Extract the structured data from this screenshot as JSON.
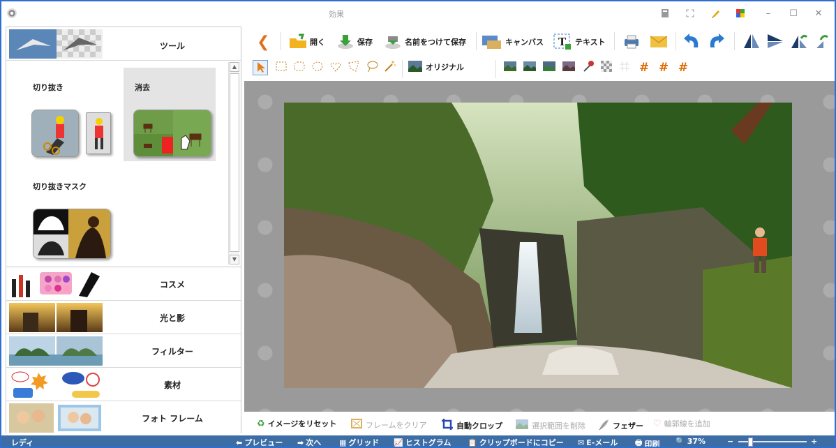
{
  "window": {
    "title": "効果"
  },
  "titlebar_icons": [
    "document-icon",
    "fullscreen-icon",
    "pencil-icon",
    "palette-icon",
    "minimize-icon",
    "maximize-icon",
    "close-icon"
  ],
  "left_panel": {
    "tools_category": {
      "label": "ツール"
    },
    "tools": [
      {
        "name": "切り抜き"
      },
      {
        "name": "消去",
        "selected": true
      },
      {
        "name": "切り抜きマスク"
      }
    ],
    "categories": [
      {
        "label": "コスメ"
      },
      {
        "label": "光と影"
      },
      {
        "label": "フィルター"
      },
      {
        "label": "素材"
      },
      {
        "label": "フォト フレーム"
      }
    ]
  },
  "toolbar": {
    "back_label": "",
    "open_label": "開く",
    "save_label": "保存",
    "save_as_label": "名前をつけて保存",
    "canvas_label": "キャンバス",
    "text_label": "テキスト"
  },
  "toolbar2": {
    "original_label": "オリジナル"
  },
  "bottom_tools": {
    "reset_label": "イメージをリセット",
    "clear_frame_label": "フレームをクリア",
    "auto_crop_label": "自動クロップ",
    "delete_selection_label": "選択範囲を削除",
    "feather_label": "フェザー",
    "add_outline_label": "輪郭線を追加"
  },
  "statusbar": {
    "status": "レディ",
    "preview_label": "プレビュー",
    "next_label": "次へ",
    "grid_label": "グリッド",
    "histogram_label": "ヒストグラム",
    "copy_clipboard_label": "クリップボードにコピー",
    "email_label": "E-メール",
    "print_label": "印刷",
    "zoom_label": "37%",
    "zoom_minus": "−",
    "zoom_plus": "+"
  },
  "colors": {
    "accent_blue": "#2f6fd0",
    "statusbar_bg": "#3c6da5",
    "canvas_bg": "#9a9a9a",
    "selected_tile_bg": "#e4e4e4"
  }
}
